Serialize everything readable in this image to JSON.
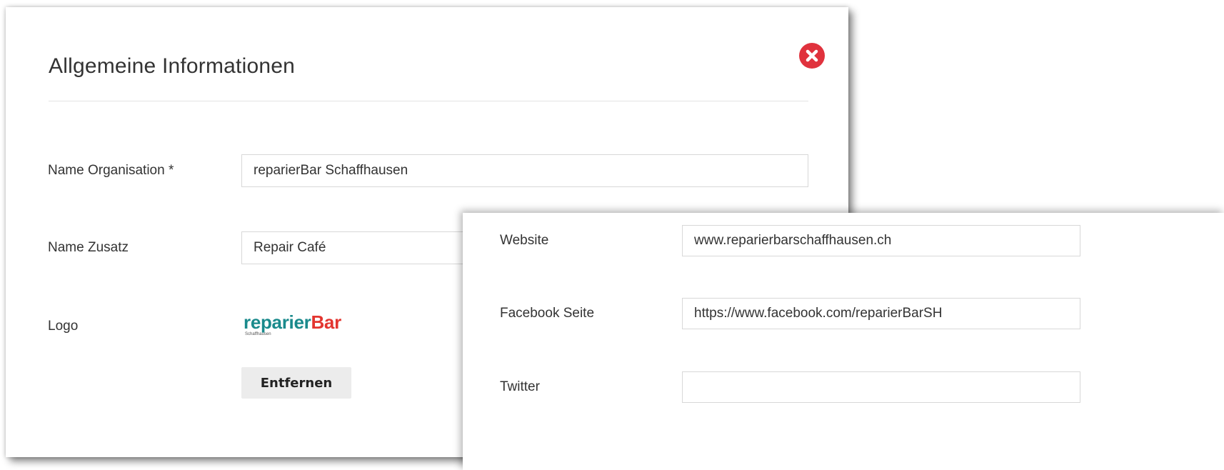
{
  "modal": {
    "title": "Allgemeine Informationen",
    "close_icon": "close-icon",
    "close_color": "#e0323d"
  },
  "form": {
    "name_organisation": {
      "label": "Name Organisation *",
      "value": "reparierBar Schaffhausen"
    },
    "name_zusatz": {
      "label": "Name Zusatz",
      "value": "Repair Café"
    },
    "logo": {
      "label": "Logo",
      "logo_text_part1": "reparier",
      "logo_text_part2": "Bar",
      "logo_subtext": "Schaffhausen",
      "logo_colors": [
        "#1a8a8c",
        "#e3352f"
      ],
      "remove_label": "Entfernen"
    },
    "website": {
      "label": "Website",
      "value": "www.reparierbarschaffhausen.ch"
    },
    "facebook": {
      "label": "Facebook Seite",
      "value": "https://www.facebook.com/reparierBarSH"
    },
    "twitter": {
      "label": "Twitter",
      "value": ""
    }
  }
}
